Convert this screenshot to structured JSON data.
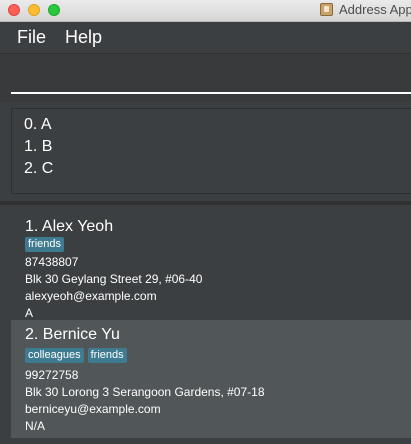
{
  "window": {
    "title": "Address App",
    "colors": {
      "background": "#3c3f41",
      "selected_card": "#515658",
      "tag": "#3e7b91"
    }
  },
  "menu": {
    "items": [
      "File",
      "Help"
    ]
  },
  "command": {
    "value": ""
  },
  "result": {
    "lines": [
      "0. A",
      "1. B",
      "2. C"
    ]
  },
  "persons": [
    {
      "index": "1.",
      "name": "Alex Yeoh",
      "tags": [
        "friends"
      ],
      "phone": "87438807",
      "address": "Blk 30 Geylang Street 29, #06-40",
      "email": "alexyeoh@example.com",
      "extra": "A"
    },
    {
      "index": "2.",
      "name": "Bernice Yu",
      "tags": [
        "colleagues",
        "friends"
      ],
      "phone": "99272758",
      "address": "Blk 30 Lorong 3 Serangoon Gardens, #07-18",
      "email": "berniceyu@example.com",
      "extra": "N/A"
    }
  ]
}
